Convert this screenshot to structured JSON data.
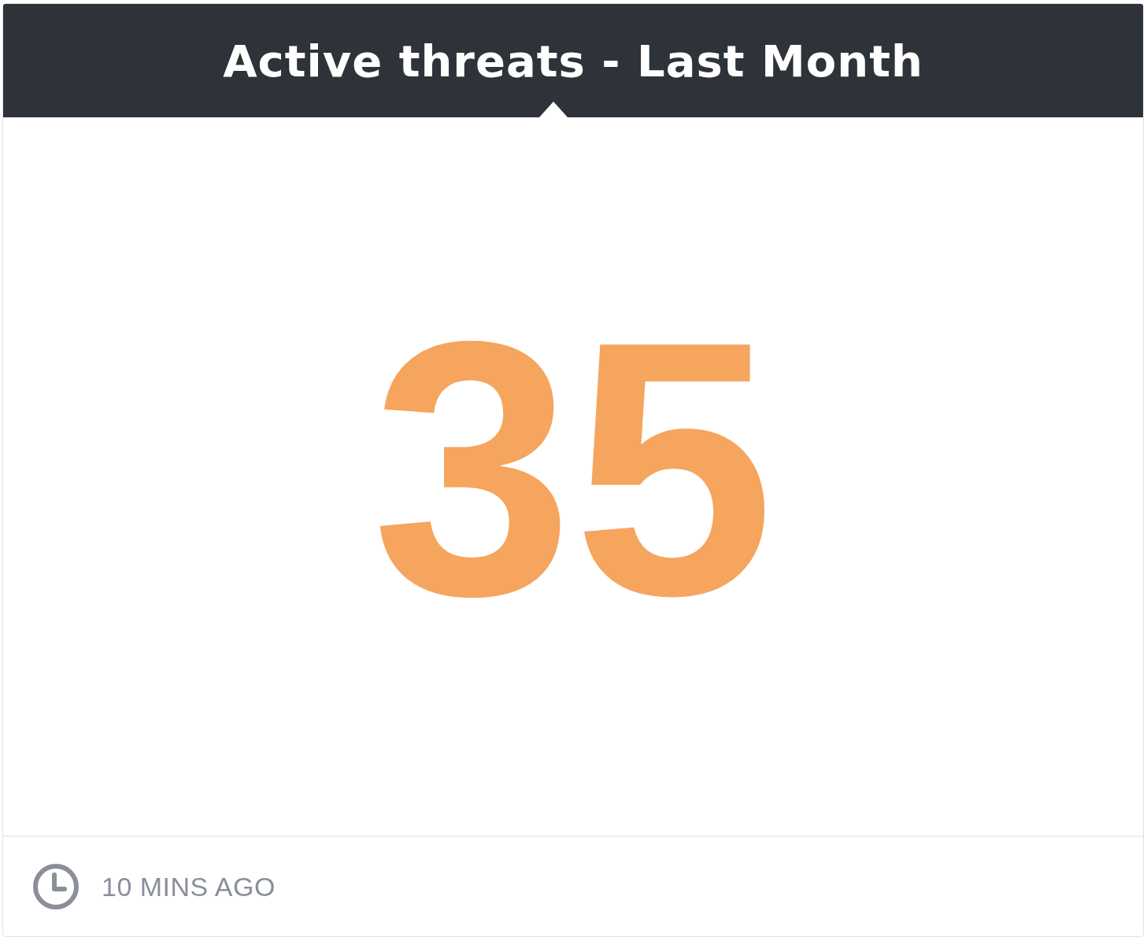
{
  "widget": {
    "title": "Active threats - Last Month",
    "value": "35",
    "updated": "10 MINS AGO"
  }
}
